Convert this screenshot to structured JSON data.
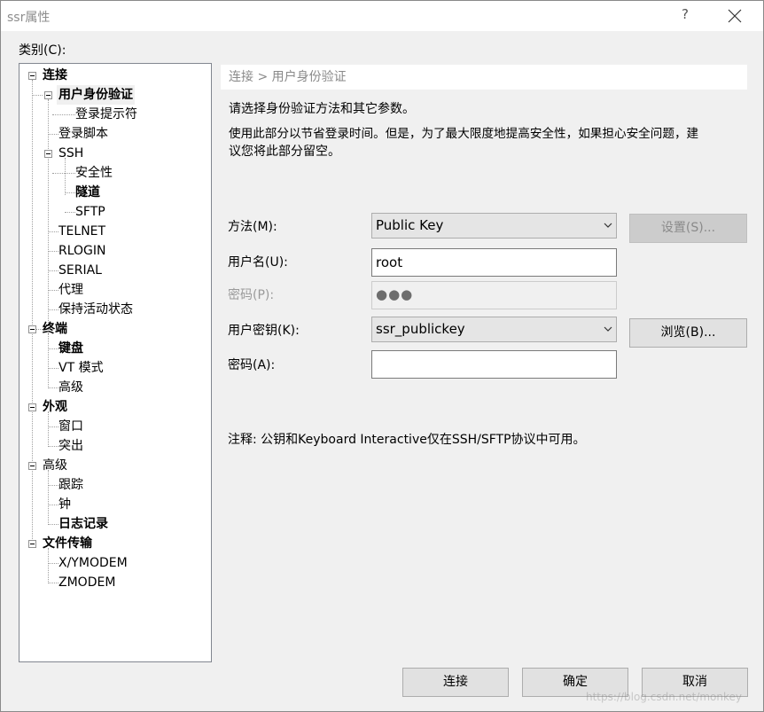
{
  "window": {
    "title": "ssr属性",
    "help_label": "?"
  },
  "category_label": "类别(C):",
  "tree": [
    {
      "label": "连接",
      "bold": true
    },
    {
      "label": "用户身份验证",
      "bold": true
    },
    {
      "label": "登录提示符",
      "bold": false
    },
    {
      "label": "登录脚本",
      "bold": false
    },
    {
      "label": "SSH",
      "bold": false
    },
    {
      "label": "安全性",
      "bold": false
    },
    {
      "label": "隧道",
      "bold": true
    },
    {
      "label": "SFTP",
      "bold": false
    },
    {
      "label": "TELNET",
      "bold": false
    },
    {
      "label": "RLOGIN",
      "bold": false
    },
    {
      "label": "SERIAL",
      "bold": false
    },
    {
      "label": "代理",
      "bold": false
    },
    {
      "label": "保持活动状态",
      "bold": false
    },
    {
      "label": "终端",
      "bold": true
    },
    {
      "label": "键盘",
      "bold": true
    },
    {
      "label": "VT 模式",
      "bold": false
    },
    {
      "label": "高级",
      "bold": false
    },
    {
      "label": "外观",
      "bold": true
    },
    {
      "label": "窗口",
      "bold": false
    },
    {
      "label": "突出",
      "bold": false
    },
    {
      "label": "高级",
      "bold": false
    },
    {
      "label": "跟踪",
      "bold": false
    },
    {
      "label": "钟",
      "bold": false
    },
    {
      "label": "日志记录",
      "bold": true
    },
    {
      "label": "文件传输",
      "bold": true
    },
    {
      "label": "X/YMODEM",
      "bold": false
    },
    {
      "label": "ZMODEM",
      "bold": false
    }
  ],
  "panel": {
    "breadcrumb": "连接 > 用户身份验证",
    "intro": "请选择身份验证方法和其它参数。",
    "description_line1": "使用此部分以节省登录时间。但是，为了最大限度地提高安全性，如果担心安全问题，建",
    "description_line2": "议您将此部分留空。",
    "method_label": "方法(M):",
    "method_value": "Public Key",
    "settings_button": "设置(S)...",
    "username_label": "用户名(U):",
    "username_value": "root",
    "password_label": "密码(P):",
    "password_value": "●●●",
    "userkey_label": "用户密钥(K):",
    "userkey_value": "ssr_publickey",
    "browse_button": "浏览(B)...",
    "passphrase_label": "密码(A):",
    "passphrase_value": "",
    "note": "注释: 公钥和Keyboard Interactive仅在SSH/SFTP协议中可用。"
  },
  "footer": {
    "connect": "连接",
    "ok": "确定",
    "cancel": "取消"
  },
  "watermark": "https://blog.csdn.net/monkey"
}
